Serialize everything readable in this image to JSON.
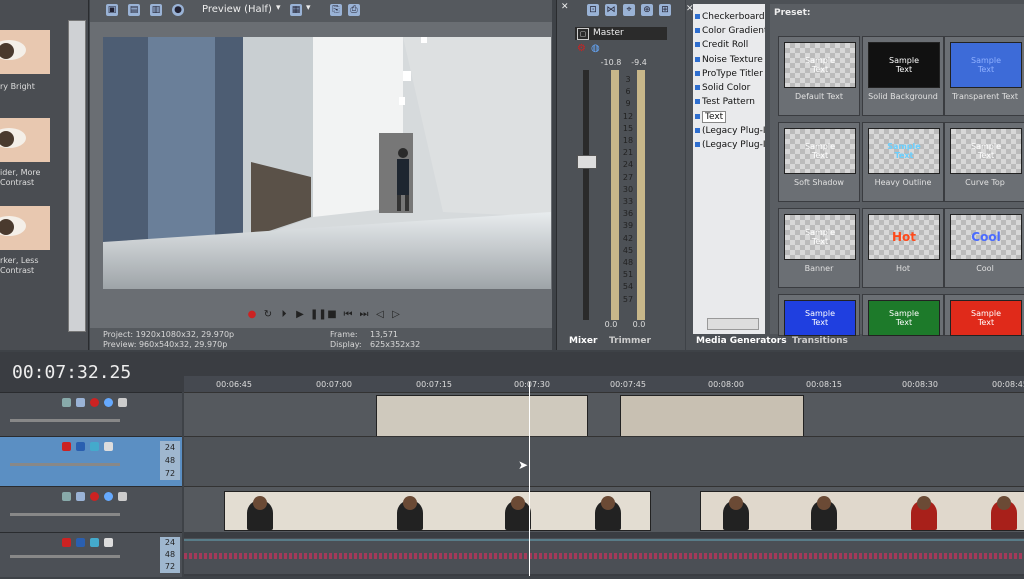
{
  "preview": {
    "quality": "Preview (Half)",
    "project": "Project:   1920x1080x32, 29.970p",
    "preview": "Preview:   960x540x32, 29.970p",
    "frame_label": "Frame:",
    "frame_value": "13,571",
    "display_label": "Display:",
    "display_value": "625x352x32"
  },
  "left_fx": [
    {
      "label": "ry Bright"
    },
    {
      "label": "ider, More\nContrast"
    },
    {
      "label": "rker, Less\nContrast"
    }
  ],
  "mixer": {
    "master_label": "Master",
    "peak_left": "-10.8",
    "peak_right": "-9.4",
    "scale": [
      "3",
      "6",
      "9",
      "12",
      "15",
      "18",
      "21",
      "24",
      "27",
      "30",
      "33",
      "36",
      "39",
      "42",
      "45",
      "48",
      "51",
      "54",
      "57"
    ],
    "bottom_left": "0.0",
    "bottom_right": "0.0",
    "tab_mixer": "Mixer",
    "tab_trimmer": "Trimmer"
  },
  "generators": {
    "items": [
      "Checkerboard",
      "Color Gradient",
      "Credit Roll",
      "Noise Texture",
      "ProType Titler",
      "Solid Color",
      "Test Pattern",
      "Text",
      "(Legacy Plug-In",
      "(Legacy Plug-In"
    ],
    "selected": "Text",
    "preset_heading": "Preset:",
    "tab_media_generators": "Media Generators",
    "tab_transitions": "Transitions",
    "presets": [
      {
        "name": "Default Text",
        "sample": "Sample\nText"
      },
      {
        "name": "Solid Background",
        "sample": "Sample\nText"
      },
      {
        "name": "Transparent Text",
        "sample": "Sample\nText"
      },
      {
        "name": "Soft Shadow",
        "sample": "Sample\nText"
      },
      {
        "name": "Heavy Outline",
        "sample": "Sample\nText"
      },
      {
        "name": "Curve Top",
        "sample": "Sample\nText"
      },
      {
        "name": "Banner",
        "sample": "Sample\nText"
      },
      {
        "name": "Hot",
        "sample": "Hot"
      },
      {
        "name": "Cool",
        "sample": "Cool"
      },
      {
        "name": "",
        "sample": "Sample\nText"
      },
      {
        "name": "",
        "sample": "Sample\nText"
      },
      {
        "name": "",
        "sample": "Sample\nText"
      }
    ]
  },
  "timeline": {
    "timecode": "00:07:32.25",
    "ruler": [
      "00:06:45",
      "00:07:00",
      "00:07:15",
      "00:07:30",
      "00:07:45",
      "00:08:00",
      "00:08:15",
      "00:08:30",
      "00:08:45"
    ],
    "track_levels": [
      "24",
      "48",
      "72"
    ]
  },
  "colors": {
    "accent": "#5b8fc3",
    "background": "#3e4247",
    "meter": "#c8b78a"
  }
}
